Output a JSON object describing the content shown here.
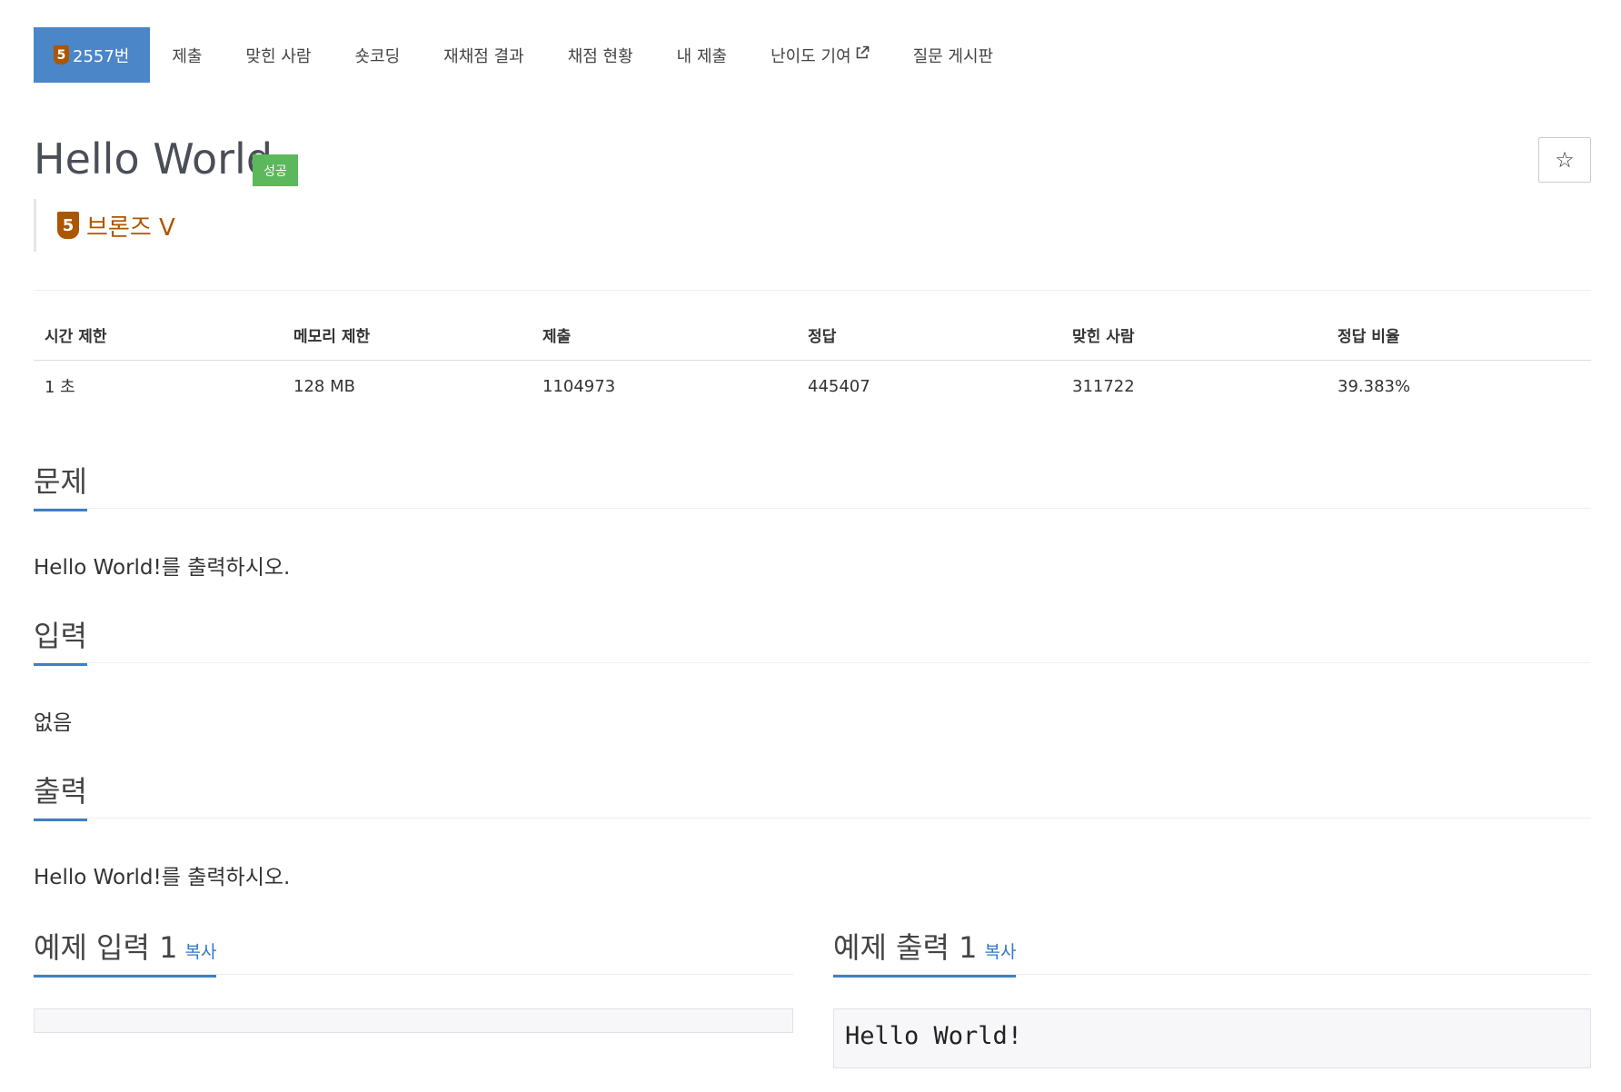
{
  "tabs": {
    "problem_tier_digit": "5",
    "problem": "2557번",
    "submit": "제출",
    "solved_users": "맞힌 사람",
    "shortest_code": "숏코딩",
    "rejudge": "재채점 결과",
    "status": "채점 현황",
    "my_submissions": "내 제출",
    "difficulty": "난이도 기여",
    "board": "질문 게시판"
  },
  "title": {
    "text": "Hello World",
    "result_badge": "성공",
    "star_icon": "star-outline-icon",
    "star_glyph": "☆"
  },
  "tier": {
    "digit": "5",
    "label": "브론즈 V",
    "color": "#ad5600"
  },
  "info_table": {
    "headers": [
      "시간 제한",
      "메모리 제한",
      "제출",
      "정답",
      "맞힌 사람",
      "정답 비율"
    ],
    "values": [
      "1 초",
      "128 MB",
      "1104973",
      "445407",
      "311722",
      "39.383%"
    ]
  },
  "sections": {
    "problem": {
      "title": "문제",
      "body": "Hello World!를 출력하시오."
    },
    "input": {
      "title": "입력",
      "body": "없음"
    },
    "output": {
      "title": "출력",
      "body": "Hello World!를 출력하시오."
    }
  },
  "samples": {
    "input_title": "예제 입력 1",
    "output_title": "예제 출력 1",
    "copy_label": "복사",
    "input_value": "",
    "output_value": "Hello World!"
  },
  "colors": {
    "accent": "#4b86c8",
    "success": "#5cb85c",
    "bronze": "#ad5600",
    "link": "#3377cc"
  }
}
